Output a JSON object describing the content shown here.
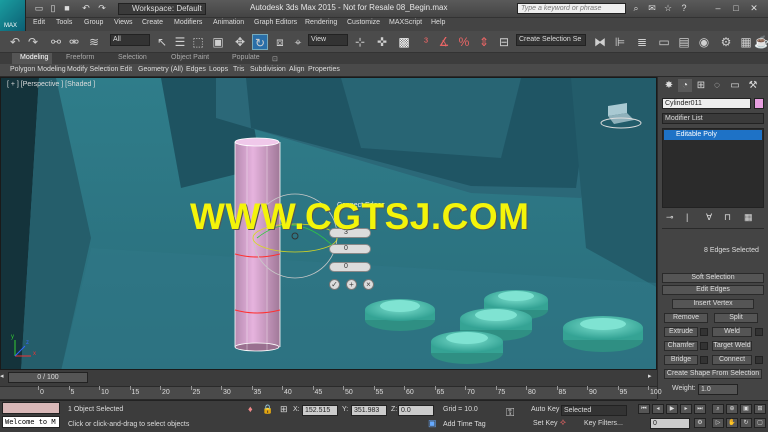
{
  "app": {
    "logo_text": "MAX",
    "title": "Autodesk 3ds Max  2015  - Not for Resale   08_Begin.max",
    "workspace": "Workspace: Default",
    "search_placeholder": "Type a keyword or phrase"
  },
  "menu": [
    "Edit",
    "Tools",
    "Group",
    "Views",
    "Create",
    "Modifiers",
    "Animation",
    "Graph Editors",
    "Rendering",
    "Customize",
    "MAXScript",
    "Help"
  ],
  "toolbar": {
    "filter": "All",
    "refcoord": "View",
    "selection_set": "Create Selection Se"
  },
  "ribbon": {
    "tabs": [
      "Modeling",
      "Freeform",
      "Selection",
      "Object Paint",
      "Populate"
    ],
    "items": [
      "Polygon Modeling",
      "Modify Selection",
      "Edit",
      "Geometry (All)",
      "Edges",
      "Loops",
      "Tris",
      "Subdivision",
      "Align",
      "Properties"
    ]
  },
  "viewport": {
    "label": "[ + ] [Perspective ] [Shaded ]",
    "watermark": "WWW.CGTSJ.COM",
    "caddy_title": "Connect Edges",
    "caddy_values": [
      "3",
      "0",
      "0"
    ],
    "axis_x": "x",
    "axis_y": "y",
    "axis_z": "z"
  },
  "panel": {
    "object_name": "Cylinder011",
    "object_color": "#e8a0e0",
    "modifier_list": "Modifier List",
    "stack_item": "Editable Poly",
    "selection_status": "8 Edges Selected",
    "soft_selection": "Soft Selection",
    "edit_edges": "Edit Edges",
    "insert_vertex": "Insert Vertex",
    "remove": "Remove",
    "split": "Split",
    "extrude": "Extrude",
    "weld": "Weld",
    "chamfer": "Chamfer",
    "target_weld": "Target Weld",
    "bridge": "Bridge",
    "connect": "Connect",
    "create_shape": "Create Shape From Selection",
    "weight_label": "Weight:",
    "weight_value": "1.0"
  },
  "timeline": {
    "slider": "0 / 100",
    "ticks": [
      "0",
      "5",
      "10",
      "15",
      "20",
      "25",
      "30",
      "35",
      "40",
      "45",
      "50",
      "55",
      "60",
      "65",
      "70",
      "75",
      "80",
      "85",
      "90",
      "95",
      "100"
    ]
  },
  "status": {
    "selected": "1 Object Selected",
    "prompt": "Click or click-and-drag to select objects",
    "welcome": "Welcome to M",
    "x_label": "X:",
    "x_value": "152.515",
    "y_label": "Y:",
    "y_value": "351.983",
    "z_label": "Z:",
    "z_value": "0.0",
    "grid": "Grid = 10.0",
    "add_time_tag": "Add Time Tag",
    "auto_key": "Auto Key",
    "set_key": "Set Key",
    "selected_dropdown": "Selected",
    "key_filters": "Key Filters...",
    "frame": "0"
  }
}
